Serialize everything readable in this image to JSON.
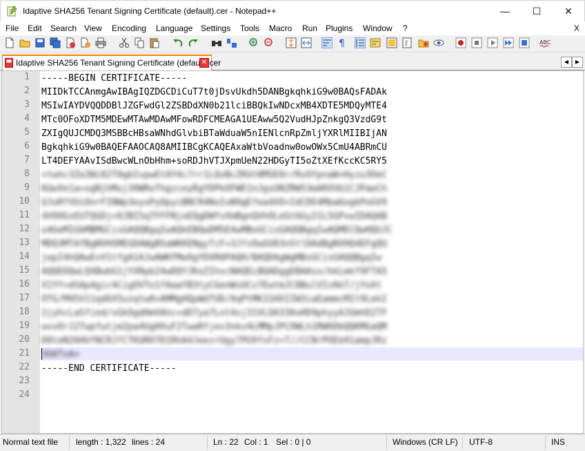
{
  "window": {
    "title": "Idaptive SHA256 Tenant Signing Certificate (default).cer - Notepad++",
    "minimize": "—",
    "maximize": "☐",
    "close": "✕"
  },
  "menu": {
    "items": [
      "File",
      "Edit",
      "Search",
      "View",
      "Encoding",
      "Language",
      "Settings",
      "Tools",
      "Macro",
      "Run",
      "Plugins",
      "Window",
      "?"
    ],
    "close": "X"
  },
  "tab": {
    "label": "Idaptive SHA256 Tenant Signing Certificate (default).cer",
    "close": "✕",
    "prev": "◀",
    "next": "▶"
  },
  "editor": {
    "line_numbers": [
      "1",
      "2",
      "3",
      "4",
      "5",
      "6",
      "7",
      "8",
      "9",
      "10",
      "11",
      "12",
      "13",
      "14",
      "15",
      "16",
      "17",
      "18",
      "19",
      "20",
      "21",
      "22",
      "23",
      "24"
    ],
    "lines": [
      "-----BEGIN CERTIFICATE-----",
      "MIIDkTCCAnmgAwIBAgIQZDGCDiCuT7t0jDsvUkdh5DANBgkqhkiG9w0BAQsFADAk",
      "MSIwIAYDVQQDDBlJZGFwdGl2ZSBDdXN0b21lciBBQkIwNDcxMB4XDTE5MDQyMTE4",
      "MTc0OFoXDTM5MDEwMTAwMDAwMFowRDFCMEAGA1UEAww5Q2VudHJpZnkgQ3VzdG9t",
      "ZXIgQUJCMDQ3MSBBcHBsaWNhdGlvbiBTaWduaW5nIENlcnRpZmljYXRlMIIBIjAN",
      "BgkqhkiG9w0BAQEFAAOCAQ8AMIIBCgKCAQEAxaWtbVoadnw0owOWx5CmU4ABRmCU",
      "LT4DEFYAAvISdBwcWLnObHhm+soRDJhVTJXpmUeN22HDGyTI5oZtXEfKccKC5RY5",
      "+twhc3Ze2Wi82T0gbIvpwEtAY4c7rr1LQvBcZKUt0MSE0r/RvOfpnaW+Hyzu3OeC",
      "KUwVe1a+ogNjhMuj39WRoThgzceyRgYDPkOFWE1nJgsUNZRW53mARXVb1CJPaeCh",
      "UJuRfVUiOnrFINWp3eyoPyOpyiBNCR4NoIuN9gEfea4XO+IdCDE4Mba6ogkPoGV9",
      "4VOOGxEUTQGDj+0JBI5qTFFFNjoEQgDWYvXmBgnQVhOLeGt6Gy21L5GPvwIDAQAB",
      "o4GeMIGbMBMGCisGAQQBgqIwAQkEBQwDMSE4wMBoGCisGAQQBgqIwAQMECQwHQUJC",
      "MDQ3MTAfBgNVHSMEGDAWgBSaWKKENgyTcF+3JfvOwGU83nStlDAdBgNVHQ4EFgQU",
      "jepI4hQAwEvV1tfgA1AJwAWKFMwOgYDVR0PAQH/BAQDAgWgMBsGCisGAQQBgqIw",
      "AQQEDQwLQXBwbG1jYXRpb24wDQYJKoZIhvcNAQELBQADggEBAAsx/kkLmkf9FTA5",
      "X1YY+dSAp4gic4CigOVTo1fAaaYB3tyCGenWsUCv7EwtmJC8BulVIzAkT/jYoXt",
      "OTG/M95V11qd6X5uzqtw0+AMMgHQpWdTUD/0qPtMK31HXIIW3iaEammcMIt9LekI",
      "2jyhcLaSfied/vGkOgdHmVAhc+dD7ya7Lnt4sj31VLOA330uHD9phyyAJUmhD2TF",
      "wvvOrJ2Twpfwtjm2pa4UgHXuF2TwaRfjev3nkv4LMMpJPCOWLh1RW6DbQQKMGaQM",
      "D8teN26HUfNCRJfCTKURO7D1RhA4JeezrUgy7PU9fxFz+T//CCNrPOEb91ampJRz",
      "3OATxA=",
      "-----END CERTIFICATE-----",
      "",
      ""
    ]
  },
  "status": {
    "type": "Normal text file",
    "length": "length : 1,322",
    "lines": "lines : 24",
    "ln": "Ln : 22",
    "col": "Col : 1",
    "sel": "Sel : 0 | 0",
    "eol": "Windows (CR LF)",
    "encoding": "UTF-8",
    "mode": "INS"
  },
  "icons": [
    "new-file-icon",
    "open-file-icon",
    "save-icon",
    "save-all-icon",
    "close-icon",
    "close-all-icon",
    "print-icon",
    "cut-icon",
    "copy-icon",
    "paste-icon",
    "undo-icon",
    "redo-icon",
    "find-icon",
    "replace-icon",
    "zoom-in-icon",
    "zoom-out-icon",
    "sync-vertical-icon",
    "sync-horizontal-icon",
    "word-wrap-icon",
    "show-all-chars-icon",
    "indent-guide-icon",
    "udl-icon",
    "doc-map-icon",
    "function-list-icon",
    "folder-workspace-icon",
    "monitor-icon",
    "record-macro-icon",
    "stop-record-icon",
    "play-macro-icon",
    "play-multiple-icon",
    "save-macro-icon",
    "spell-check-icon"
  ]
}
